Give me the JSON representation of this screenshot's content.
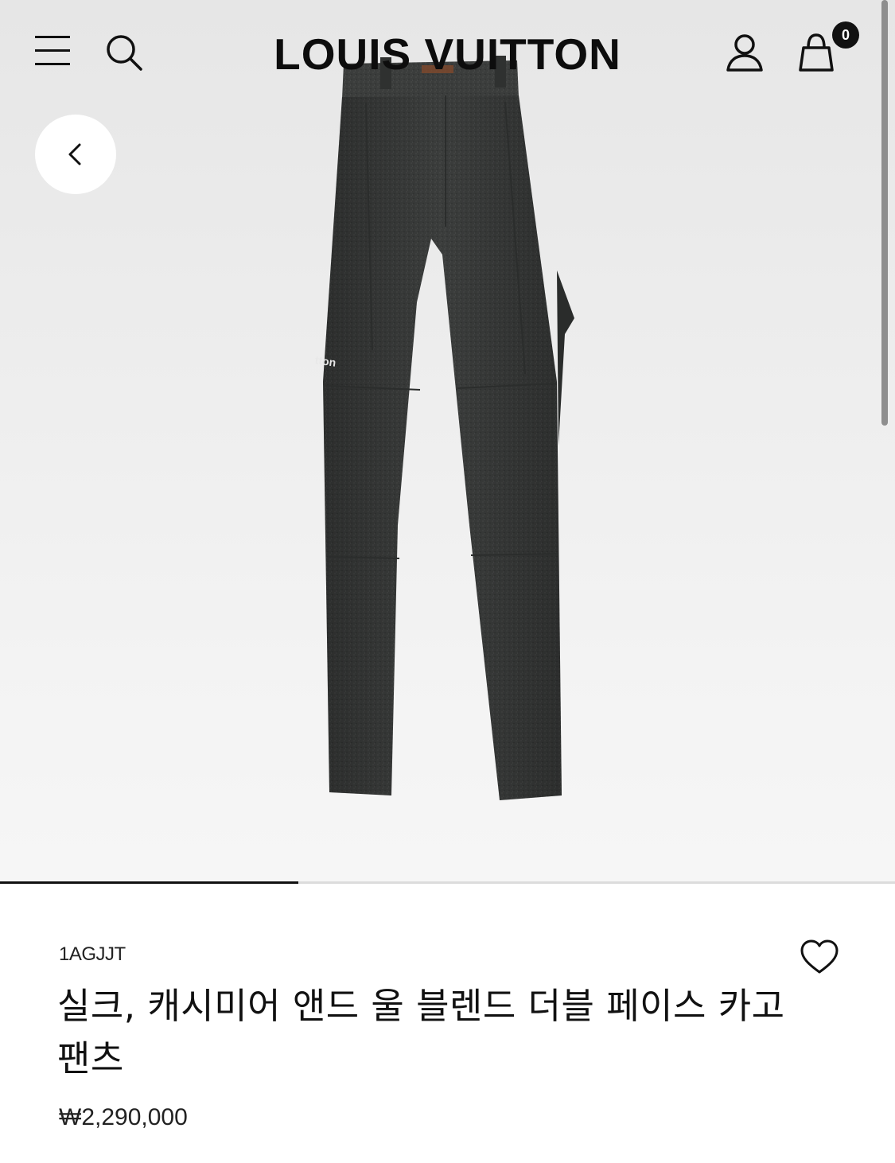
{
  "header": {
    "brand": "LOUIS VUITTON",
    "cart_count": "0",
    "icons": {
      "menu": "hamburger-menu-icon",
      "search": "search-icon",
      "account": "user-icon",
      "bag": "shopping-bag-icon",
      "back": "chevron-left-icon"
    }
  },
  "gallery": {
    "progress": 0.333,
    "pocket_logo_text": "tton"
  },
  "product": {
    "sku": "1AGJJT",
    "title": "실크, 캐시미어 앤드 울 블렌드 더블 페이스 카고 팬츠",
    "price": "₩2,290,000",
    "wishlist_icon": "heart-outline-icon"
  },
  "colors": {
    "fabric": "#3a3c3b",
    "background": "#ececec",
    "text": "#111111"
  }
}
